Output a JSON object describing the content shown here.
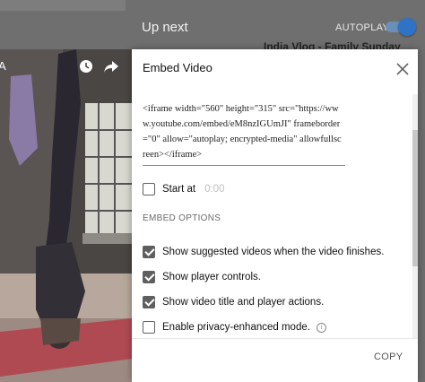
{
  "sidebar": {
    "up_next_label": "Up next",
    "autoplay_label": "AUTOPLAY",
    "autoplay_on": true,
    "first_video_title": "India Vlog - Family Sunday",
    "toggle_color": "#2e73c8"
  },
  "player": {
    "icons": [
      "clock-icon",
      "share-icon"
    ],
    "left_letter": "A"
  },
  "dialog": {
    "title": "Embed Video",
    "close_icon": "close-icon",
    "embed_code": "<iframe width=\"560\" height=\"315\" src=\"https://www.youtube.com/embed/eM8nzIGUmJI\" frameborder=\"0\" allow=\"autoplay; encrypted-media\" allowfullscreen></iframe>",
    "start_at": {
      "label": "Start at",
      "time": "0:00",
      "checked": false
    },
    "embed_options_label": "EMBED OPTIONS",
    "options": [
      {
        "label": "Show suggested videos when the video finishes.",
        "checked": true
      },
      {
        "label": "Show player controls.",
        "checked": true
      },
      {
        "label": "Show video title and player actions.",
        "checked": true
      },
      {
        "label": "Enable privacy-enhanced mode.",
        "checked": false
      }
    ],
    "copy_label": "COPY"
  }
}
